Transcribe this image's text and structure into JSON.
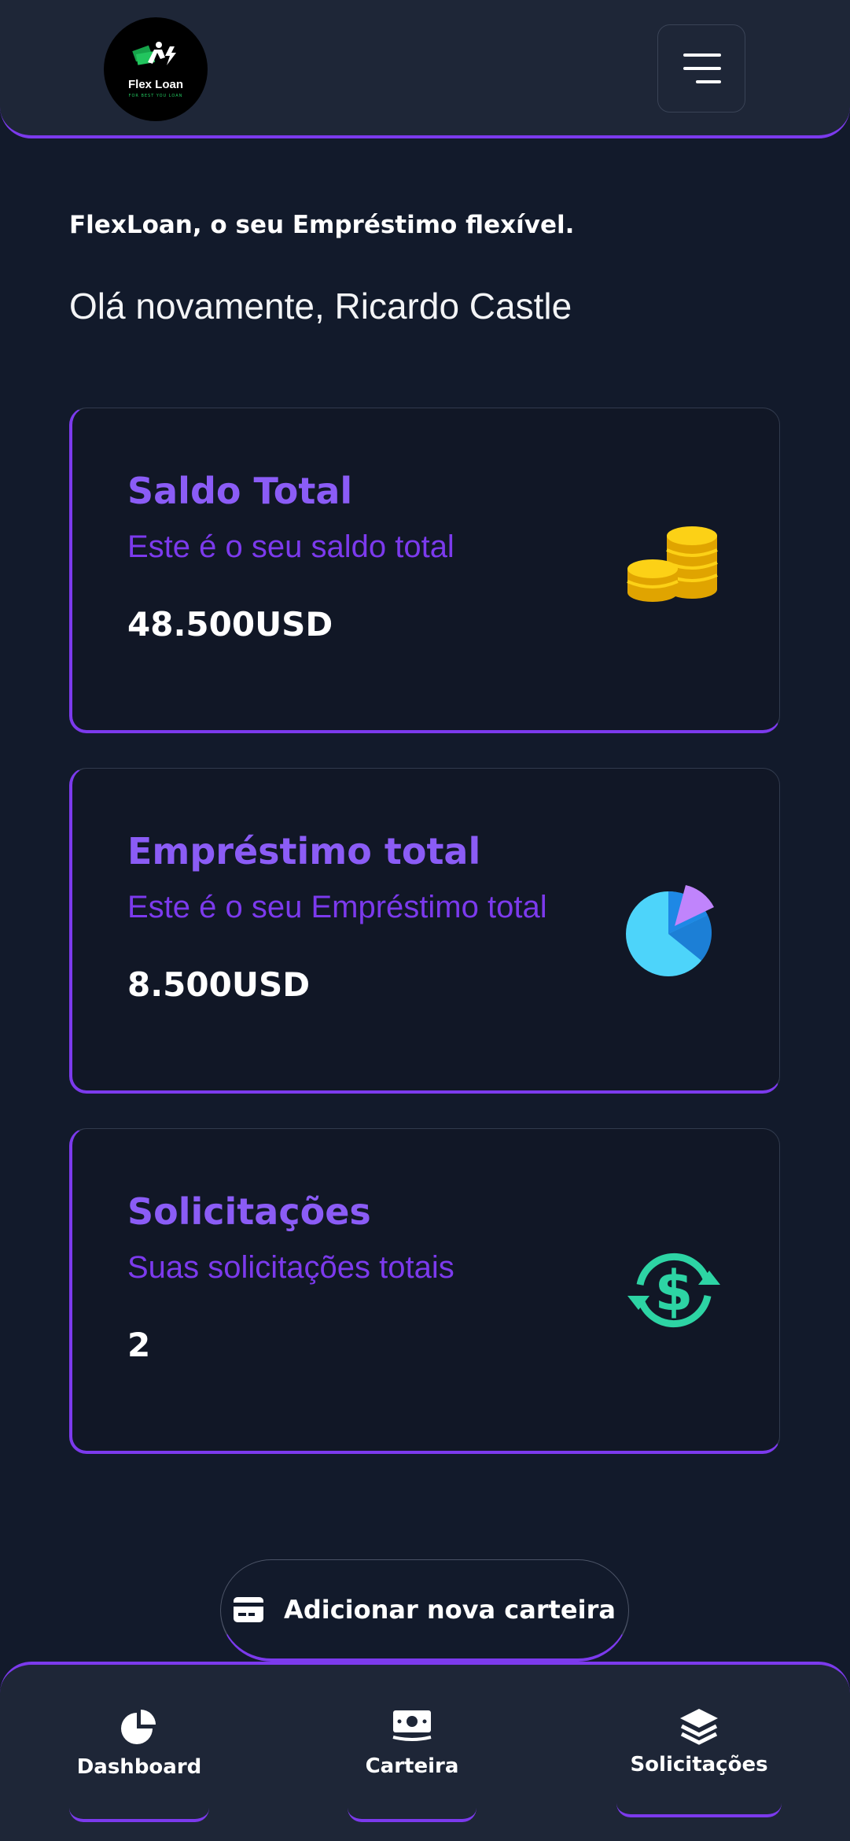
{
  "header": {
    "logo_text": "Flex Loan",
    "logo_tagline": "FOR BEST YOU LOAN",
    "menu_icon": "hamburger-menu-icon"
  },
  "tagline": "FlexLoan, o seu Empréstimo flexível.",
  "greeting": "Olá novamente, Ricardo Castle",
  "cards": [
    {
      "title": "Saldo Total",
      "subtitle": "Este é o seu saldo total",
      "value": "48.500USD",
      "icon": "coins-icon"
    },
    {
      "title": "Empréstimo total",
      "subtitle": "Este é o seu Empréstimo total",
      "value": "8.500USD",
      "icon": "pie-chart-icon"
    },
    {
      "title": "Solicitações",
      "subtitle": "Suas solicitações totais",
      "value": "2",
      "icon": "dollar-exchange-icon"
    }
  ],
  "add_wallet": {
    "label": "Adicionar nova carteira",
    "icon": "credit-card-icon"
  },
  "bottom_nav": [
    {
      "label": "Dashboard",
      "icon": "pie-chart-icon"
    },
    {
      "label": "Carteira",
      "icon": "money-icon"
    },
    {
      "label": "Solicitações",
      "icon": "layers-icon"
    }
  ],
  "colors": {
    "accent": "#7c3aed",
    "accent_light": "#8b5cf6",
    "background": "#121a2b",
    "surface": "#1e2637"
  }
}
